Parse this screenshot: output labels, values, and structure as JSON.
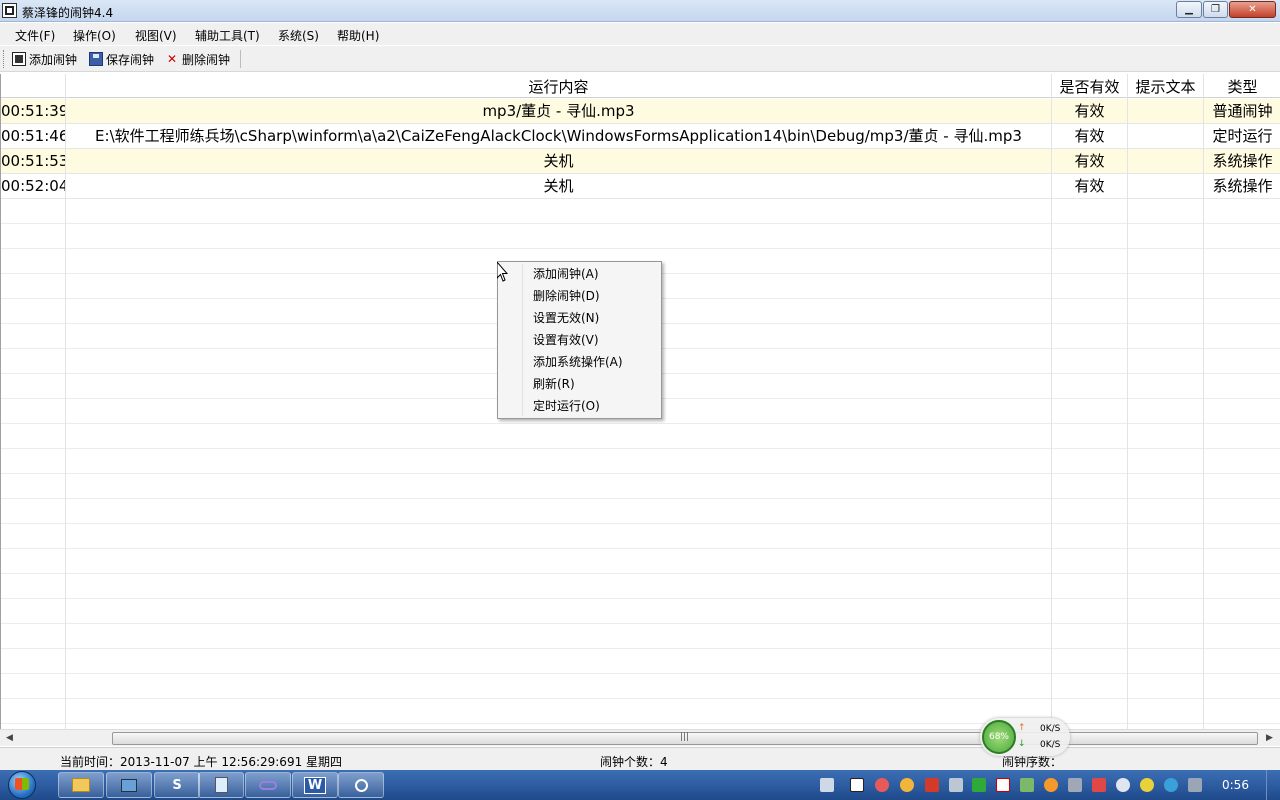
{
  "window": {
    "title": "蔡泽锋的闹钟4.4",
    "min_icon": "minimize-icon",
    "max_icon": "maximize-icon",
    "close_icon": "close-icon",
    "min_glyph": "▁",
    "max_glyph": "❐",
    "close_glyph": "✕"
  },
  "menu": {
    "file": "文件(F)",
    "operate": "操作(O)",
    "view": "视图(V)",
    "tools": "辅助工具(T)",
    "system": "系统(S)",
    "help": "帮助(H)"
  },
  "toolbar": {
    "add": "添加闹钟",
    "save": "保存闹钟",
    "delete": "删除闹钟",
    "delete_glyph": "✕"
  },
  "grid": {
    "headers": {
      "content": "运行内容",
      "valid": "是否有效",
      "tip": "提示文本",
      "type": "类型"
    },
    "rows": [
      {
        "time": "00:51:39",
        "content": "mp3/董贞 - 寻仙.mp3",
        "valid": "有效",
        "tip": "",
        "type": "普通闹钟"
      },
      {
        "time": "00:51:46",
        "content": "E:\\软件工程师练兵场\\cSharp\\winform\\a\\a2\\CaiZeFengAlackClock\\WindowsFormsApplication14\\bin\\Debug/mp3/董贞 - 寻仙.mp3",
        "valid": "有效",
        "tip": "",
        "type": "定时运行"
      },
      {
        "time": "00:51:53",
        "content": "关机",
        "valid": "有效",
        "tip": "",
        "type": "系统操作"
      },
      {
        "time": "00:52:04",
        "content": "关机",
        "valid": "有效",
        "tip": "",
        "type": "系统操作"
      }
    ]
  },
  "context_menu": {
    "items": [
      "添加闹钟(A)",
      "删除闹钟(D)",
      "设置无效(N)",
      "设置有效(V)",
      "添加系统操作(A)",
      "刷新(R)",
      "定时运行(O)"
    ]
  },
  "scrollbar": {
    "left_arrow": "◀",
    "right_arrow": "▶",
    "grip": "|||"
  },
  "status": {
    "current_time": "当前时间：2013-11-07 上午 12:56:29:691  星期四",
    "alarm_count": "闹钟个数：4",
    "alarm_seq": "闹钟序数："
  },
  "net_monitor": {
    "percent": "68%",
    "up_rate": "0K/S",
    "down_rate": "0K/S",
    "up_arrow": "↑",
    "down_arrow": "↓"
  },
  "taskbar": {
    "clock": "0:56",
    "app_w_label": "W",
    "app_s_label": "S"
  },
  "colors": {
    "row_alt": "#fffbe0",
    "taskbar": "#2a5aa0",
    "gauge": "#4aa83a"
  }
}
